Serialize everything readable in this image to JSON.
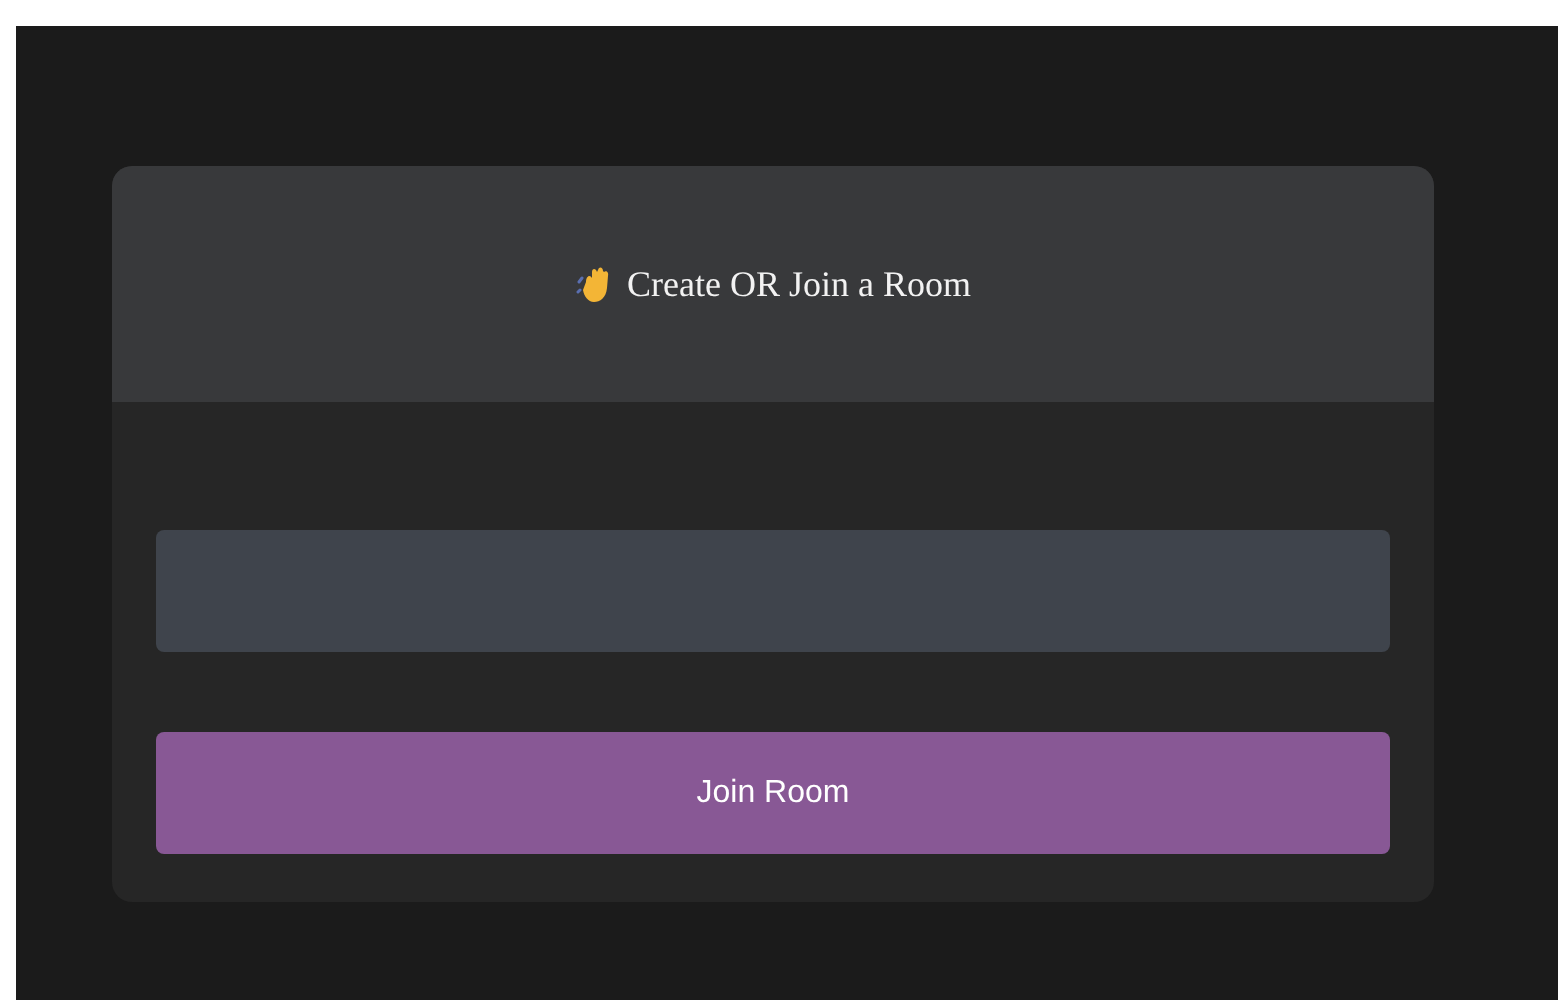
{
  "card": {
    "title": "Create OR Join a Room"
  },
  "join_button": {
    "label": "Join Room"
  }
}
